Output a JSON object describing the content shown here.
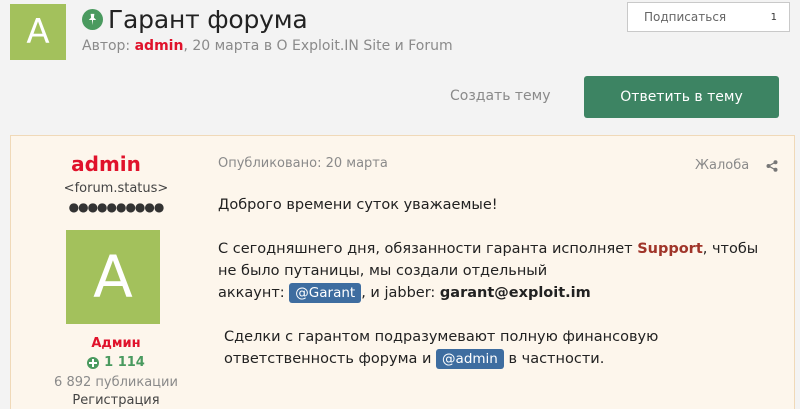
{
  "header": {
    "avatar_letter": "A",
    "pin_icon": "pin-icon",
    "title": "Гарант форума",
    "byline_prefix": "Автор: ",
    "author": "admin",
    "byline_suffix": ", 20 марта в О Exploit.IN Site и Forum",
    "subscribe_label": "Подписаться",
    "subscribe_count": "1",
    "create_topic_label": "Создать тему",
    "reply_label": "Ответить в тему"
  },
  "post": {
    "author_name": "admin",
    "author_status": "<forum.status>",
    "rank_dots": "●●●●●●●●●●",
    "avatar_letter": "A",
    "group": "Админ",
    "reputation": "1 114",
    "posts_count": "6 892 публикации",
    "registration_label": "Регистрация",
    "published": "Опубликовано: 20 марта",
    "report_label": "Жалоба",
    "share_icon": "share-icon",
    "body": {
      "greeting": "Доброго времени суток уважаемые!",
      "p2_part1": "С сегодняшнего дня, обязанности гаранта исполняет ",
      "p2_support": "Support",
      "p2_part2": ", чтобы не было путаницы, мы создали отдельный",
      "p2_line3_prefix": "аккаунт: ",
      "p2_mention": "@Garant",
      "p2_line3_mid": ", и jabber: ",
      "p2_jabber": "garant@exploit.im",
      "p3_part1": "Сделки с гарантом подразумевают полную финансовую ответственность форума и ",
      "p3_mention": "@admin",
      "p3_part2": " в частности."
    }
  },
  "colors": {
    "avatar_bg": "#a3c15c",
    "accent_green": "#3d8463",
    "author_red": "#e0122b",
    "mention_blue": "#3e6da0",
    "post_bg": "#fdf6ec"
  }
}
